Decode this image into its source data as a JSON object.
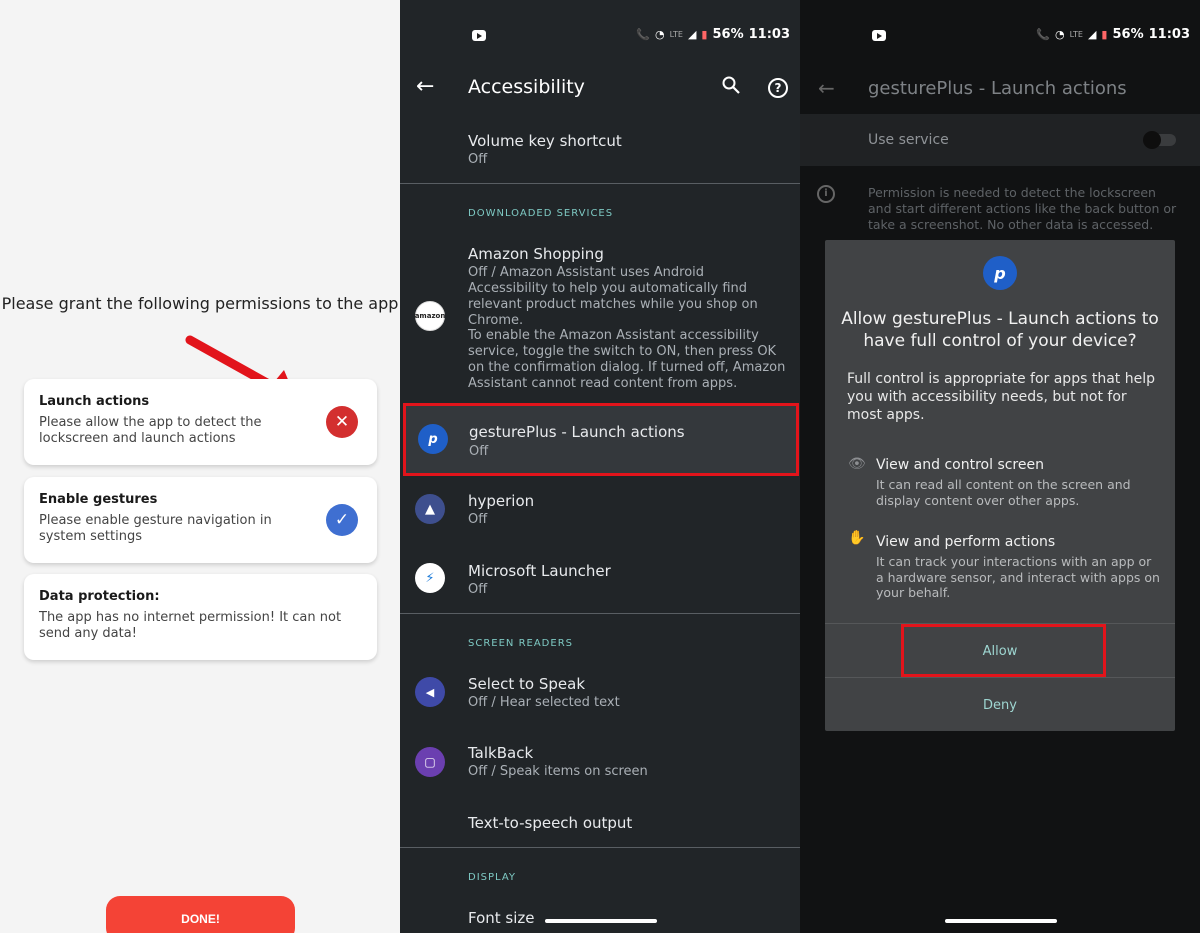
{
  "panel1": {
    "heading": "Please grant the following permissions to the app",
    "cards": [
      {
        "title": "Launch actions",
        "text": "Please allow the app to detect the lockscreen and launch actions",
        "status": "denied"
      },
      {
        "title": "Enable gestures",
        "text": "Please enable gesture navigation in system settings",
        "status": "granted"
      },
      {
        "title": "Data protection:",
        "text": "The app has no internet permission! It can not send any data!"
      }
    ],
    "done_label": "DONE!",
    "colors": {
      "denied": "#d32f2f",
      "granted": "#3f6fd1",
      "done": "#f44336",
      "arrow": "#e2141b"
    }
  },
  "statusbar": {
    "lte": "LTE",
    "battery": "56%",
    "time": "11:03"
  },
  "panel2": {
    "title": "Accessibility",
    "volume_key": {
      "title": "Volume key shortcut",
      "sub": "Off"
    },
    "downloaded_header": "DOWNLOADED SERVICES",
    "amazon": {
      "title": "Amazon Shopping",
      "sub": "Off / Amazon Assistant uses Android Accessibility to help you automatically find relevant product matches while you shop on Chrome.",
      "sub2": "To enable the Amazon Assistant accessibility service, toggle the switch to ON, then press OK on the confirmation dialog. If turned off, Amazon Assistant cannot read content from apps.",
      "icon_text": "amazon"
    },
    "gestureplus": {
      "title": "gesturePlus - Launch actions",
      "sub": "Off"
    },
    "hyperion": {
      "title": "hyperion",
      "sub": "Off"
    },
    "mslauncher": {
      "title": "Microsoft Launcher",
      "sub": "Off"
    },
    "screen_readers_header": "SCREEN READERS",
    "select_to_speak": {
      "title": "Select to Speak",
      "sub": "Off / Hear selected text"
    },
    "talkback": {
      "title": "TalkBack",
      "sub": "Off / Speak items on screen"
    },
    "tts": {
      "title": "Text-to-speech output"
    },
    "display_header": "DISPLAY",
    "font_size": {
      "title": "Font size"
    }
  },
  "panel3": {
    "title": "gesturePlus - Launch actions",
    "use_service": "Use service",
    "permission_text": "Permission is needed to detect the lockscreen and start different actions like the back button or take a screenshot. No other data is accessed.",
    "dialog": {
      "title": "Allow gesturePlus - Launch actions to have full control of your device?",
      "body": "Full control is appropriate for apps that help you with accessibility needs, but not for most apps.",
      "perm1_title": "View and control screen",
      "perm1_desc": "It can read all content on the screen and display content over other apps.",
      "perm2_title": "View and perform actions",
      "perm2_desc": "It can track your interactions with an app or a hardware sensor, and interact with apps on your behalf.",
      "allow": "Allow",
      "deny": "Deny"
    }
  }
}
